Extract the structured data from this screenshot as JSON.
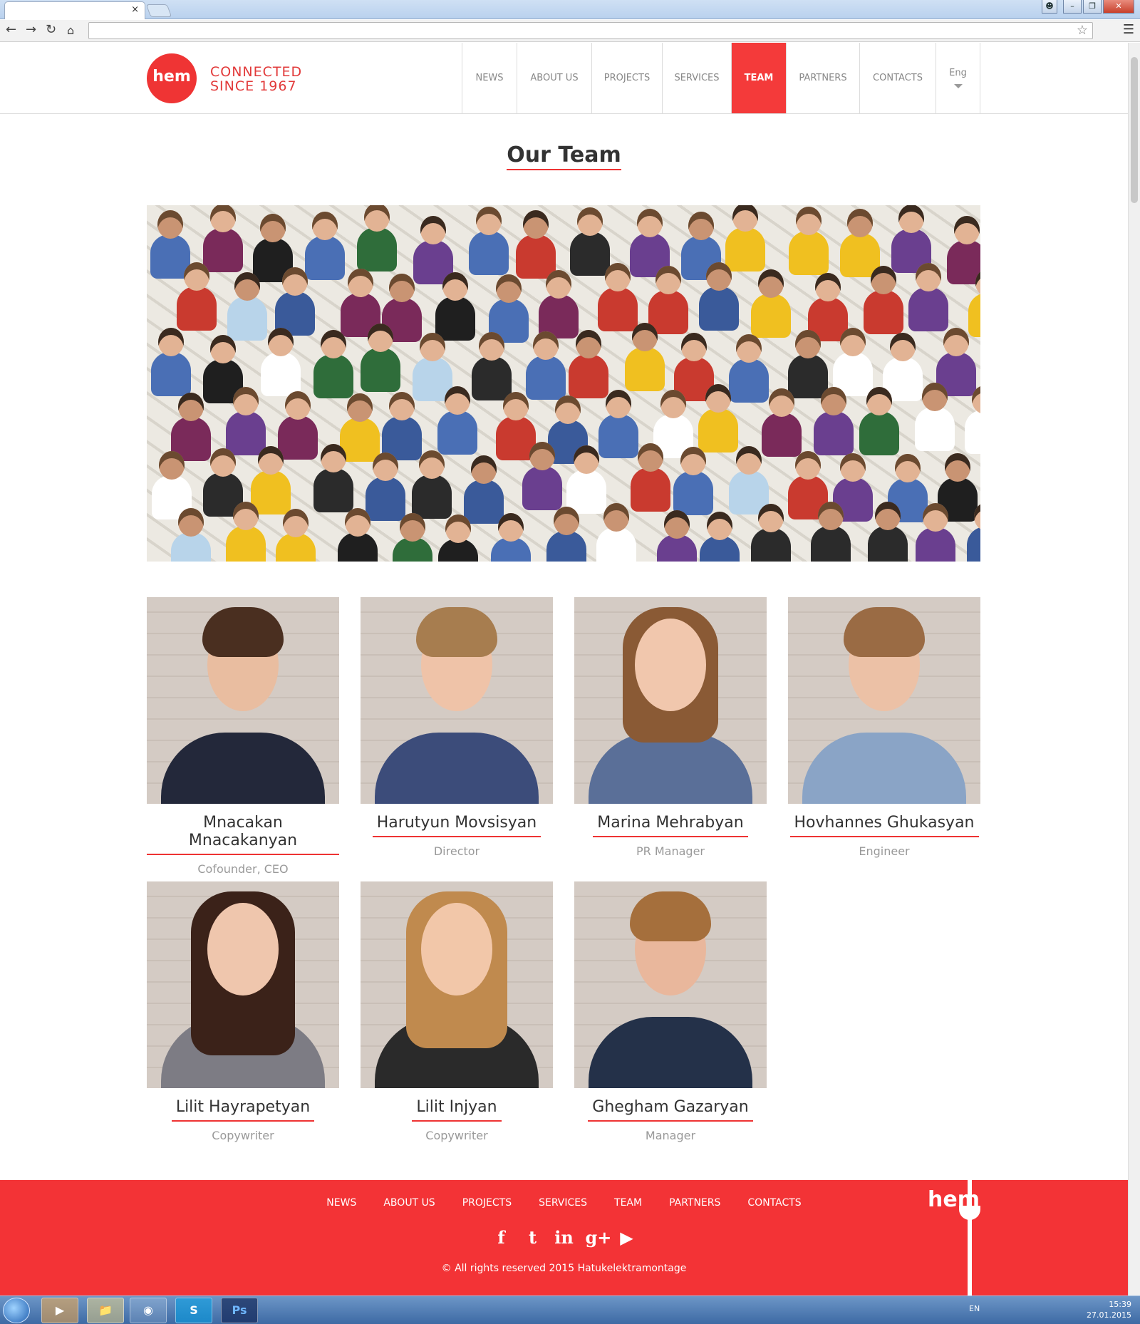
{
  "browser": {
    "tab_close": "×",
    "back_icon": "back-arrow",
    "forward_icon": "forward-arrow",
    "reload_icon": "reload",
    "home_icon": "home",
    "url": "",
    "window_buttons": [
      "minimize",
      "restore",
      "close"
    ]
  },
  "header": {
    "logo_text": "hem",
    "tagline_line1": "CONNECTED",
    "tagline_line2": "SINCE 1967",
    "nav": [
      {
        "label": "NEWS",
        "active": false
      },
      {
        "label": "ABOUT US",
        "active": false
      },
      {
        "label": "PROJECTS",
        "active": false
      },
      {
        "label": "SERVICES",
        "active": false
      },
      {
        "label": "TEAM",
        "active": true
      },
      {
        "label": "PARTNERS",
        "active": false
      },
      {
        "label": "CONTACTS",
        "active": false
      }
    ],
    "language": "Eng"
  },
  "main": {
    "title": "Our Team",
    "members": [
      {
        "name": "Mnacakan Mnacakanyan",
        "role": "Cofounder, CEO"
      },
      {
        "name": "Harutyun Movsisyan",
        "role": "Director"
      },
      {
        "name": "Marina Mehrabyan",
        "role": "PR Manager"
      },
      {
        "name": "Hovhannes Ghukasyan",
        "role": "Engineer"
      },
      {
        "name": "Lilit Hayrapetyan",
        "role": "Copywriter"
      },
      {
        "name": "Lilit Injyan",
        "role": "Copywriter"
      },
      {
        "name": "Ghegham Gazaryan",
        "role": "Manager"
      }
    ]
  },
  "footer": {
    "nav": [
      "NEWS",
      "ABOUT US",
      "PROJECTS",
      "SERVICES",
      "TEAM",
      "PARTNERS",
      "CONTACTS"
    ],
    "social": [
      {
        "icon": "facebook-icon",
        "glyph": "f"
      },
      {
        "icon": "twitter-icon",
        "glyph": "t"
      },
      {
        "icon": "linkedin-icon",
        "glyph": "in"
      },
      {
        "icon": "google-plus-icon",
        "glyph": "g+"
      },
      {
        "icon": "youtube-icon",
        "glyph": "▶"
      }
    ],
    "copyright": "© All rights reserved 2015 Hatukelektramontage",
    "logo_text": "hem"
  },
  "taskbar": {
    "apps": [
      "media-player",
      "file-explorer",
      "chrome",
      "skype",
      "photoshop"
    ],
    "photoshop_label": "Ps",
    "skype_label": "S",
    "language": "EN",
    "time": "15:39",
    "date": "27.01.2015"
  },
  "colors": {
    "accent": "#f43a3a",
    "footer": "#f33336",
    "text_dark": "#333333",
    "text_muted": "#999999"
  }
}
